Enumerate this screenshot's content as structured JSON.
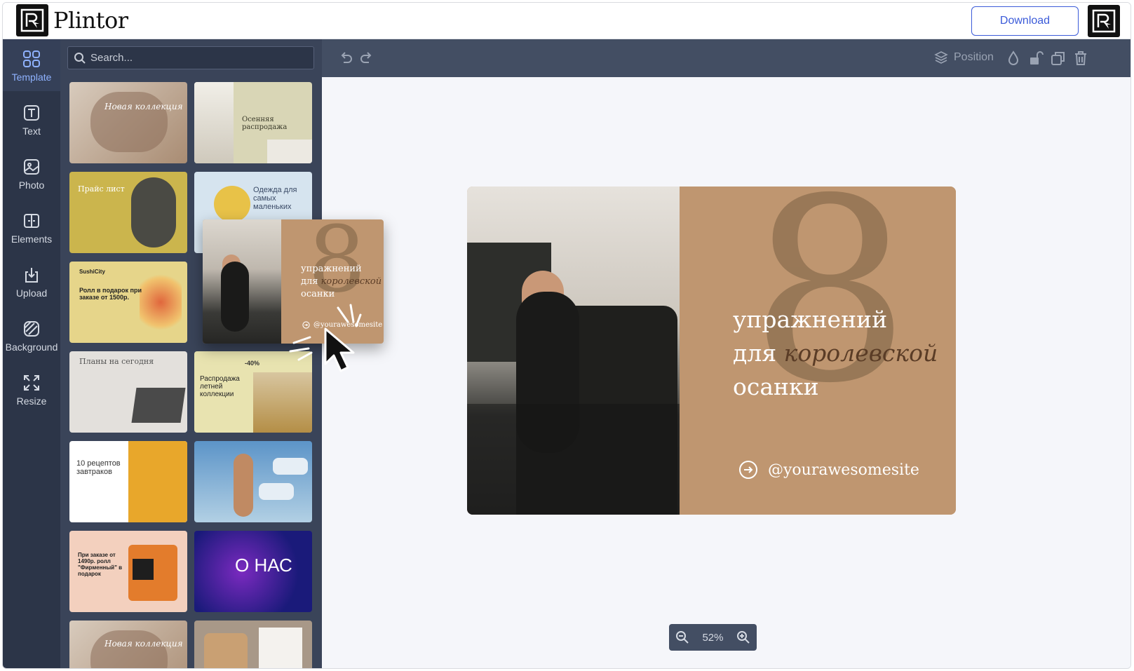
{
  "app": {
    "name": "Plintor",
    "download_label": "Download"
  },
  "rail": [
    {
      "label": "Template",
      "icon": "grid-icon",
      "active": true
    },
    {
      "label": "Text",
      "icon": "text-icon"
    },
    {
      "label": "Photo",
      "icon": "image-icon"
    },
    {
      "label": "Elements",
      "icon": "elements-icon"
    },
    {
      "label": "Upload",
      "icon": "upload-icon"
    },
    {
      "label": "Background",
      "icon": "background-icon"
    },
    {
      "label": "Resize",
      "icon": "resize-icon"
    }
  ],
  "search": {
    "placeholder": "Search..."
  },
  "templates": [
    {
      "text": "Новая коллекция"
    },
    {
      "text": "Осенняя распродажа"
    },
    {
      "text": "Прайс лист"
    },
    {
      "text": "Одежда для самых маленьких"
    },
    {
      "text": "Ролл в подарок при заказе от 1500р.",
      "brand": "SushiCity"
    },
    {
      "text": ""
    },
    {
      "text": "Планы на сегодня"
    },
    {
      "text": "Распродажа летней коллекции",
      "badge": "-40%"
    },
    {
      "text": "10 рецептов завтраков"
    },
    {
      "text": ""
    },
    {
      "text": "При заказе от 1490р. ролл \"Фирменный\" в подарок"
    },
    {
      "text": "О НАС"
    },
    {
      "text": "Новая коллекция"
    },
    {
      "text": ""
    }
  ],
  "toolbar": {
    "position_label": "Position"
  },
  "design": {
    "number": "8",
    "line1": "упражнений",
    "line2_plain": "для",
    "line2_italic": "королевской",
    "line3": "осанки",
    "handle": "@yourawesomesite"
  },
  "drag_preview": {
    "number": "8",
    "line1": "упражнений",
    "line2_plain": "для",
    "line2_italic": "королевской",
    "line3": "осанки",
    "handle": "@yourawesomesite"
  },
  "zoom": {
    "level": "52%"
  },
  "colors": {
    "accent": "#3b5bd9",
    "rail_bg": "#2c3548",
    "panel_bg": "#3a4459",
    "design_tan": "#bf9670"
  }
}
